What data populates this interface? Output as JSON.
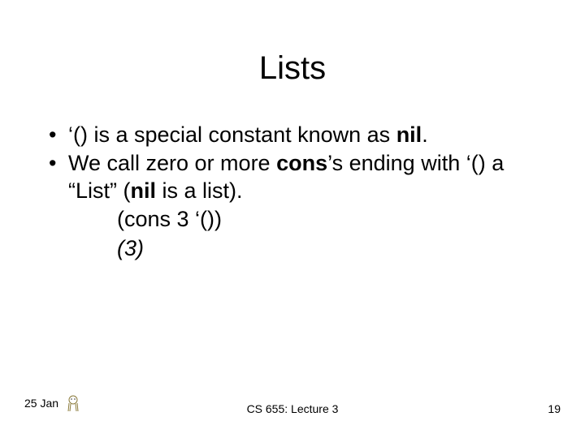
{
  "title": "Lists",
  "bullets": {
    "b1_pre": "‘() is a special constant known as ",
    "b1_nil": "nil",
    "b1_post": ".",
    "b2_pre": "We call zero or more ",
    "b2_cons": "cons",
    "b2_mid": "’s ending with ‘() a “List” (",
    "b2_nil": "nil",
    "b2_post": " is a list)."
  },
  "sub": {
    "s1": "(cons 3 ‘())",
    "s2": "(3)"
  },
  "footer": {
    "date": "25 Jan",
    "center": "CS 655: Lecture 3",
    "page": "19"
  }
}
